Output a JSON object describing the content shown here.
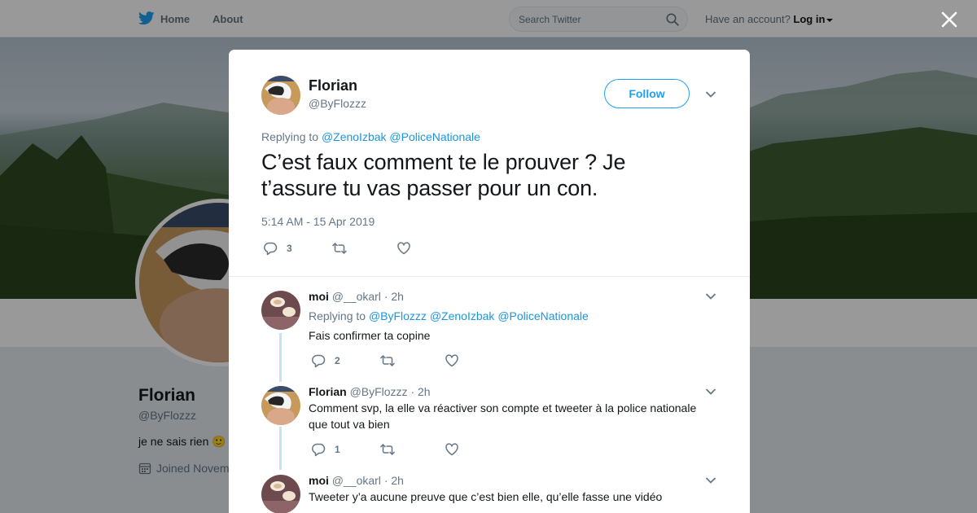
{
  "topbar": {
    "home_label": "Home",
    "about_label": "About",
    "search_placeholder": "Search Twitter",
    "account_prompt": "Have an account?",
    "login_label": "Log in"
  },
  "profile": {
    "name": "Florian",
    "handle": "@ByFlozzz",
    "bio": "je ne sais rien 🙂",
    "joined": "Joined Novem"
  },
  "main_tweet": {
    "author_name": "Florian",
    "author_handle": "@ByFlozzz",
    "follow_label": "Follow",
    "replying_prefix": "Replying to",
    "mentions": [
      "@ZenoIzbak",
      "@PoliceNationale"
    ],
    "text": "C’est faux comment te le prouver ? Je t’assure tu vas passer pour un con.",
    "timestamp": "5:14 AM - 15 Apr 2019",
    "reply_count": "3"
  },
  "replies": [
    {
      "name": "moi",
      "handle": "@__okarl",
      "time": "2h",
      "replying_prefix": "Replying to",
      "mentions": [
        "@ByFlozzz",
        "@ZenoIzbak",
        "@PoliceNationale"
      ],
      "text": "Fais confirmer ta copine",
      "reply_count": "2"
    },
    {
      "name": "Florian",
      "handle": "@ByFlozzz",
      "time": "2h",
      "text": "Comment svp, la elle va réactiver son compte et tweeter à la police nationale que tout va bien",
      "reply_count": "1"
    },
    {
      "name": "moi",
      "handle": "@__okarl",
      "time": "2h",
      "text": "Tweeter y’a aucune preuve que c’est bien elle, qu’elle fasse une vidéo"
    }
  ],
  "colors": {
    "accent": "#1da1f2",
    "mention": "#1b95e0",
    "thread_line": "#c4e3f7",
    "muted": "#657786"
  },
  "icons": [
    "twitter-bird-icon",
    "search-icon",
    "close-icon",
    "reply-icon",
    "retweet-icon",
    "like-icon",
    "chevron-down-icon",
    "calendar-icon"
  ]
}
